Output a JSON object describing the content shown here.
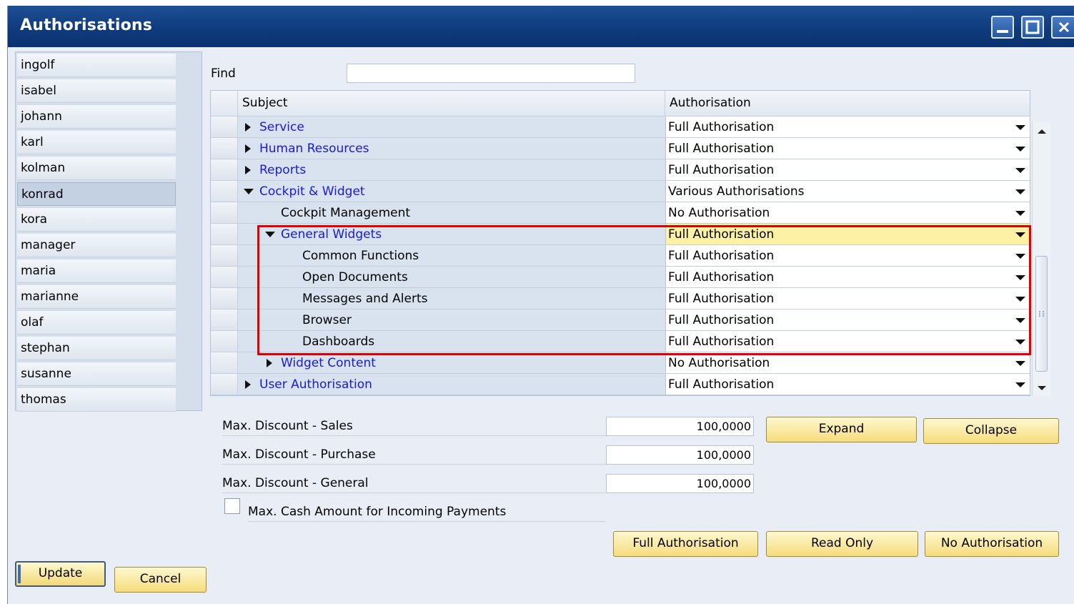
{
  "window": {
    "title": "Authorisations"
  },
  "users": [
    "ingolf",
    "isabel",
    "johann",
    "karl",
    "kolman",
    "konrad",
    "kora",
    "manager",
    "maria",
    "marianne",
    "olaf",
    "stephan",
    "susanne",
    "thomas"
  ],
  "selected_user": "konrad",
  "find": {
    "label": "Find",
    "value": ""
  },
  "grid": {
    "columns": [
      "Subject",
      "Authorisation"
    ],
    "rows": [
      {
        "subject": "Service",
        "expander": "collapsed",
        "level": 0,
        "link": true,
        "auth": "Full Authorisation"
      },
      {
        "subject": "Human Resources",
        "expander": "collapsed",
        "level": 0,
        "link": true,
        "auth": "Full Authorisation"
      },
      {
        "subject": "Reports",
        "expander": "collapsed",
        "level": 0,
        "link": true,
        "auth": "Full Authorisation"
      },
      {
        "subject": "Cockpit & Widget",
        "expander": "expanded",
        "level": 0,
        "link": true,
        "auth": "Various Authorisations"
      },
      {
        "subject": "Cockpit Management",
        "expander": "none",
        "level": 1,
        "link": false,
        "auth": "No Authorisation"
      },
      {
        "subject": "General Widgets",
        "expander": "expanded",
        "level": 1,
        "link": true,
        "auth": "Full Authorisation",
        "highlight": true
      },
      {
        "subject": "Common Functions",
        "expander": "none",
        "level": 2,
        "link": false,
        "auth": "Full Authorisation"
      },
      {
        "subject": "Open Documents",
        "expander": "none",
        "level": 2,
        "link": false,
        "auth": "Full Authorisation"
      },
      {
        "subject": "Messages and Alerts",
        "expander": "none",
        "level": 2,
        "link": false,
        "auth": "Full Authorisation"
      },
      {
        "subject": "Browser",
        "expander": "none",
        "level": 2,
        "link": false,
        "auth": "Full Authorisation"
      },
      {
        "subject": "Dashboards",
        "expander": "none",
        "level": 2,
        "link": false,
        "auth": "Full Authorisation"
      },
      {
        "subject": "Widget Content",
        "expander": "collapsed",
        "level": 1,
        "link": true,
        "auth": "No Authorisation"
      },
      {
        "subject": "User Authorisation",
        "expander": "collapsed",
        "level": 0,
        "link": true,
        "auth": "Full Authorisation"
      }
    ]
  },
  "discounts": {
    "sales_label": "Max. Discount - Sales",
    "sales_value": "100,0000",
    "purchase_label": "Max. Discount - Purchase",
    "purchase_value": "100,0000",
    "general_label": "Max. Discount - General",
    "general_value": "100,0000"
  },
  "cash": {
    "label": "Max. Cash Amount for Incoming Payments",
    "checked": false
  },
  "buttons": {
    "expand": "Expand",
    "collapse": "Collapse",
    "full_auth": "Full Authorisation",
    "read_only": "Read Only",
    "no_auth": "No Authorisation",
    "update": "Update",
    "cancel": "Cancel"
  },
  "colors": {
    "title_bar": "#0e3a7c",
    "link_text": "#1a1ad6",
    "highlight_row": "#fdf1a5",
    "selection_box": "#e00000",
    "button_yellow": "#f5dc7c"
  }
}
